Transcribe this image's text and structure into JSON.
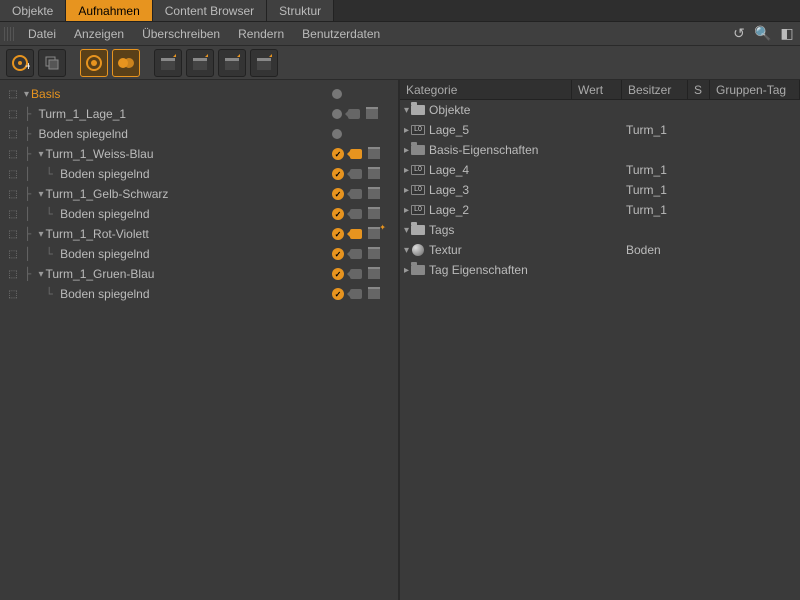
{
  "tabs": [
    "Objekte",
    "Aufnahmen",
    "Content Browser",
    "Struktur"
  ],
  "active_tab": 1,
  "menu": [
    "Datei",
    "Anzeigen",
    "Überschreiben",
    "Rendern",
    "Benutzerdaten"
  ],
  "toolbar": [
    {
      "name": "new-take-icon"
    },
    {
      "name": "duplicate-take-icon"
    },
    {
      "name": "auto-take-icon",
      "active": true
    },
    {
      "name": "override-icon",
      "active": true
    },
    {
      "name": "clapper-1-icon"
    },
    {
      "name": "clapper-2-icon"
    },
    {
      "name": "clapper-3-icon"
    },
    {
      "name": "clapper-4-icon"
    }
  ],
  "tree": [
    {
      "line": "",
      "label": "Basis",
      "root": true,
      "twisty": "▾",
      "status": "dot"
    },
    {
      "line": "├ ",
      "label": "Turm_1_Lage_1",
      "status": "dot-cams"
    },
    {
      "line": "├ ",
      "label": "Boden spiegelnd",
      "status": "dot"
    },
    {
      "line": "├ ",
      "label": "Turm_1_Weiss-Blau",
      "twisty": "▾",
      "status": "check-cam"
    },
    {
      "line": "│  └ ",
      "label": "Boden spiegelnd",
      "status": "check"
    },
    {
      "line": "├ ",
      "label": "Turm_1_Gelb-Schwarz",
      "twisty": "▾",
      "status": "check-cams-dim"
    },
    {
      "line": "│  └ ",
      "label": "Boden spiegelnd",
      "status": "check"
    },
    {
      "line": "├ ",
      "label": "Turm_1_Rot-Violett",
      "twisty": "▾",
      "status": "check-cam-spark"
    },
    {
      "line": "│  └ ",
      "label": "Boden spiegelnd",
      "status": "check"
    },
    {
      "line": "├ ",
      "label": "Turm_1_Gruen-Blau",
      "twisty": "▾",
      "status": "check-cams-dim"
    },
    {
      "line": "   └ ",
      "label": "Boden spiegelnd",
      "status": "check"
    }
  ],
  "right": {
    "headers": [
      "Kategorie",
      "Wert",
      "Besitzer",
      "S",
      "Gruppen-Tag"
    ],
    "rows": [
      {
        "indent": 0,
        "twisty": "▾",
        "icon": "folder-open",
        "label": "Objekte",
        "owner": ""
      },
      {
        "indent": 1,
        "twisty": "▸",
        "icon": "layer",
        "label": "Lage_5",
        "owner": "Turm_1"
      },
      {
        "indent": 2,
        "twisty": "▸",
        "icon": "folder-closed",
        "label": "Basis-Eigenschaften",
        "owner": ""
      },
      {
        "indent": 1,
        "twisty": "▸",
        "icon": "layer",
        "label": "Lage_4",
        "owner": "Turm_1"
      },
      {
        "indent": 1,
        "twisty": "▸",
        "icon": "layer",
        "label": "Lage_3",
        "owner": "Turm_1"
      },
      {
        "indent": 1,
        "twisty": "▸",
        "icon": "layer",
        "label": "Lage_2",
        "owner": "Turm_1"
      },
      {
        "indent": 0,
        "twisty": "▾",
        "icon": "folder-open",
        "label": "Tags",
        "owner": ""
      },
      {
        "indent": 1,
        "twisty": "▾",
        "icon": "sphere",
        "label": "Textur",
        "owner": "Boden"
      },
      {
        "indent": 2,
        "twisty": "▸",
        "icon": "folder-closed",
        "label": "Tag Eigenschaften",
        "owner": ""
      }
    ]
  },
  "colors": {
    "accent": "#e7941f"
  }
}
